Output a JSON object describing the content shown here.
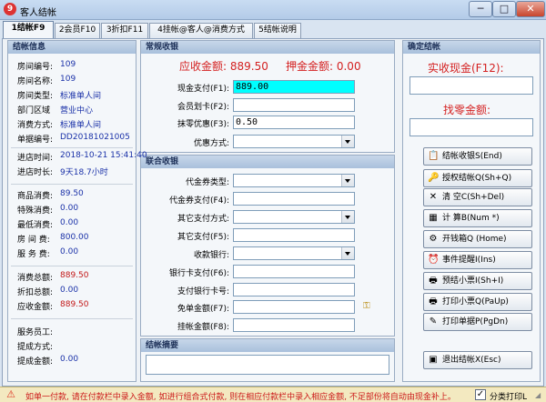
{
  "window": {
    "title": "客人结帐",
    "app_icon": "9"
  },
  "tabs": [
    "1结帐F9",
    "2会员F10",
    "3折扣F11",
    "4挂帐@客人@消费方式",
    "5结帐说明"
  ],
  "info": {
    "header": "结帐信息",
    "rows": [
      {
        "label": "房间编号:",
        "value": "109"
      },
      {
        "label": "房间名称:",
        "value": "109"
      },
      {
        "label": "房间类型:",
        "value": "标准单人间"
      },
      {
        "label": "部门区域",
        "value": "营业中心"
      },
      {
        "label": "消费方式:",
        "value": "标准单人间"
      },
      {
        "label": "单据编号:",
        "value": "DD20181021005"
      },
      {
        "label": "进店时间:",
        "value": "2018-10-21 15:41:40"
      },
      {
        "label": "进店时长:",
        "value": "9天18.7小时"
      },
      {
        "label": "商品消费:",
        "value": "89.50"
      },
      {
        "label": "特殊消费:",
        "value": "0.00"
      },
      {
        "label": "最低消费:",
        "value": "0.00"
      },
      {
        "label": "房 间 费:",
        "value": "800.00"
      },
      {
        "label": "服 务 费:",
        "value": "0.00"
      },
      {
        "label": "消费总额:",
        "value": "889.50"
      },
      {
        "label": "折扣总额:",
        "value": "0.00"
      },
      {
        "label": "应收金额:",
        "value": "889.50"
      },
      {
        "label": "服务员工:",
        "value": ""
      },
      {
        "label": "提成方式:",
        "value": ""
      },
      {
        "label": "提成金额:",
        "value": "0.00"
      }
    ]
  },
  "regular": {
    "header": "常规收银",
    "receivable_text": "应收金额: 889.50",
    "deposit_text": "押金金额: 0.00",
    "fields": [
      {
        "label": "现金支付(F1):",
        "value": "889.00"
      },
      {
        "label": "会员划卡(F2):",
        "value": ""
      },
      {
        "label": "抹零优惠(F3):",
        "value": "0.50"
      },
      {
        "label": "优惠方式:",
        "value": ""
      }
    ]
  },
  "combined": {
    "header": "联合收银",
    "fields": [
      {
        "label": "代金券类型:",
        "value": ""
      },
      {
        "label": "代金券支付(F4):",
        "value": ""
      },
      {
        "label": "其它支付方式:",
        "value": ""
      },
      {
        "label": "其它支付(F5):",
        "value": ""
      },
      {
        "label": "收款银行:",
        "value": ""
      },
      {
        "label": "银行卡支付(F6):",
        "value": ""
      },
      {
        "label": "支付银行卡号:",
        "value": ""
      },
      {
        "label": "免单金额(F7):",
        "value": ""
      },
      {
        "label": "挂帐金额(F8):",
        "value": ""
      }
    ]
  },
  "summary": {
    "header": "结帐摘要",
    "value": ""
  },
  "confirm": {
    "header": "确定结帐",
    "actual_label": "实收现金(F12):",
    "actual_value": "",
    "change_label": "找零金额:",
    "change_value": ""
  },
  "actions": [
    {
      "label": "结帐收银S(End)",
      "icon": "📋"
    },
    {
      "label": "授权结帐Q(Sh+Q)",
      "icon": "🔑"
    },
    {
      "label": "清   空C(Sh+Del)",
      "icon": "✕"
    },
    {
      "label": "计   算B(Num *)",
      "icon": "▦"
    },
    {
      "label": "开钱箱Q (Home)",
      "icon": "⚙"
    },
    {
      "label": "事件提醒I(Ins)",
      "icon": "⏰"
    },
    {
      "label": "预结小票I(Sh+I)",
      "icon": "🖶"
    },
    {
      "label": "打印小票Q(PaUp)",
      "icon": "🖶"
    },
    {
      "label": "打印单据P(PgDn)",
      "icon": "✎"
    },
    {
      "label": "退出结帐X(Esc)",
      "icon": "▣"
    }
  ],
  "status": {
    "text": "如单一付款, 请在付款栏中录入金额, 如进行组合式付款, 则在相应付款栏中录入相应金额, 不足部份将自动由现金补上。",
    "checkbox_label": "分类打印L",
    "checkbox_checked": true
  },
  "colors": {
    "cash_highlight": "#00ffff",
    "red_text": "#d42121",
    "blue_text": "#1a31a8"
  }
}
